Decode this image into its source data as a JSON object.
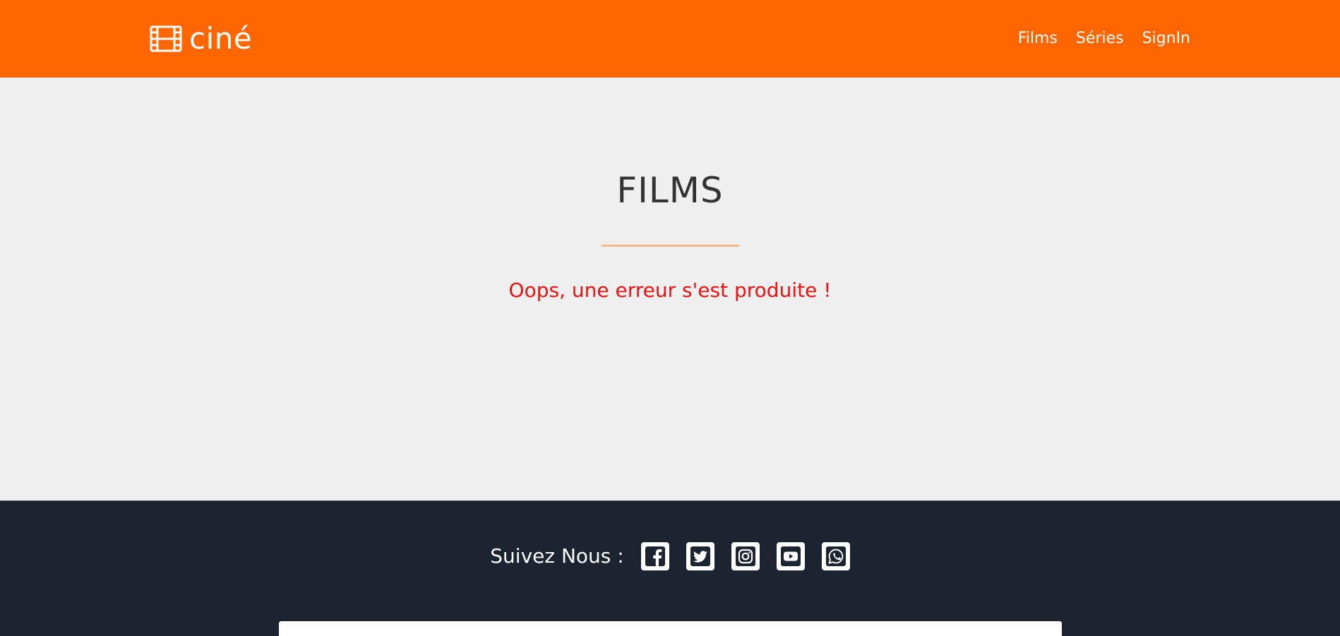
{
  "header": {
    "brand_name": "ciné",
    "brand_icon": "film-icon",
    "nav": [
      {
        "label": "Films"
      },
      {
        "label": "Séries"
      },
      {
        "label": "SignIn"
      }
    ]
  },
  "main": {
    "title": "FILMS",
    "error_message": "Oops, une erreur s'est produite !"
  },
  "footer": {
    "follow_label": "Suivez Nous :",
    "social": [
      {
        "name": "facebook-icon"
      },
      {
        "name": "twitter-icon"
      },
      {
        "name": "instagram-icon"
      },
      {
        "name": "youtube-icon"
      },
      {
        "name": "whatsapp-icon"
      }
    ]
  },
  "colors": {
    "header_bg": "#ff6600",
    "main_bg": "#efefef",
    "footer_bg": "#1c2331",
    "error": "#ee1111",
    "divider": "#f4b98a"
  }
}
